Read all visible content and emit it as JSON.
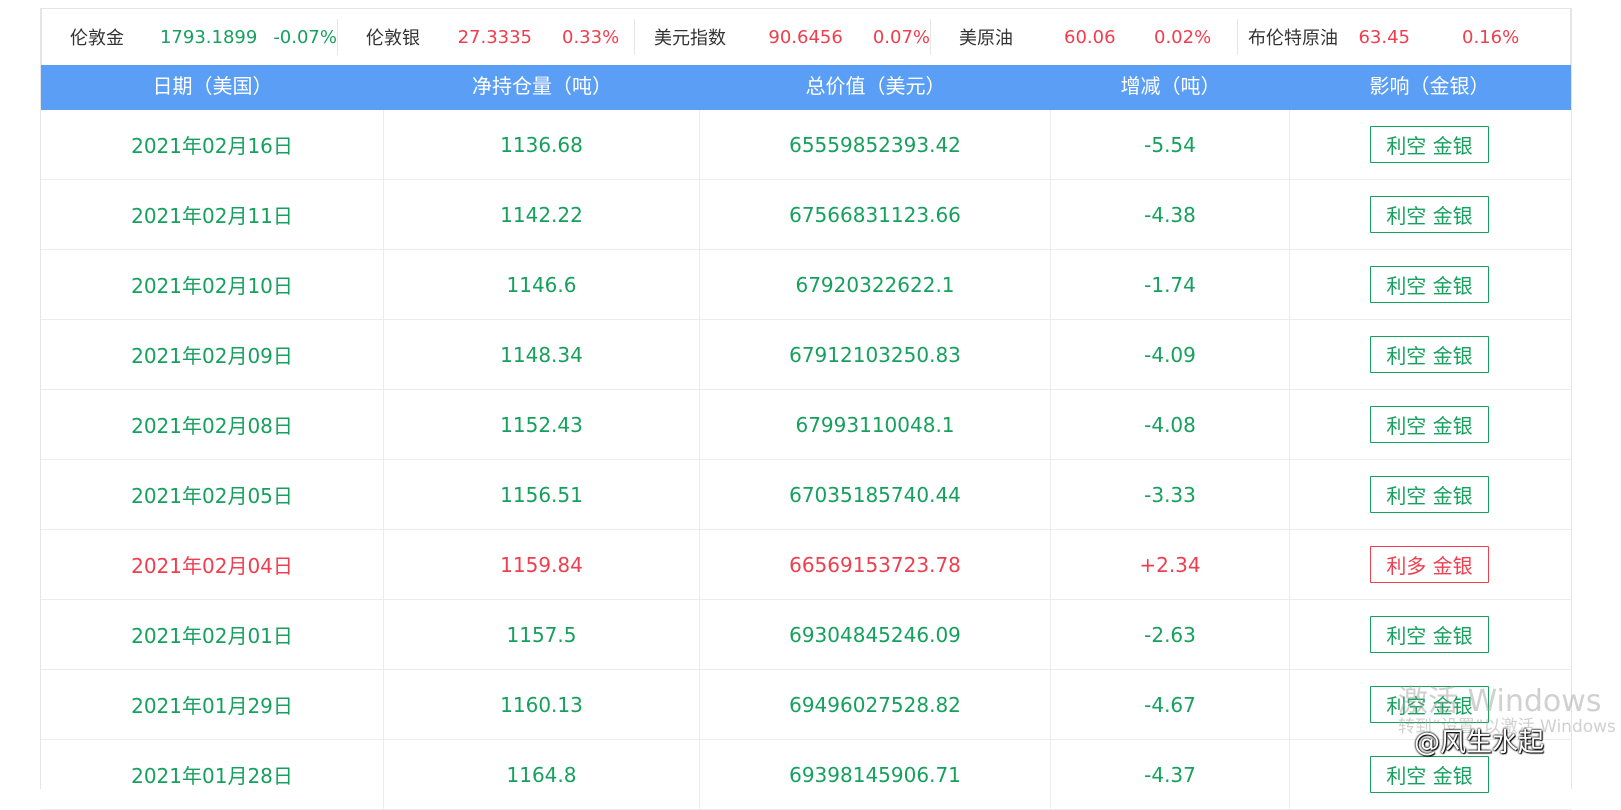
{
  "ticker": [
    {
      "name": "伦敦金",
      "price": "1793.1899",
      "change": "-0.07%",
      "trend": "down"
    },
    {
      "name": "伦敦银",
      "price": "27.3335",
      "change": "0.33%",
      "trend": "up"
    },
    {
      "name": "美元指数",
      "price": "90.6456",
      "change": "0.07%",
      "trend": "up"
    },
    {
      "name": "美原油",
      "price": "60.06",
      "change": "0.02%",
      "trend": "up"
    },
    {
      "name": "布伦特原油",
      "price": "63.45",
      "change": "0.16%",
      "trend": "up"
    }
  ],
  "table": {
    "headers": [
      "日期（美国）",
      "净持仓量（吨）",
      "总价值（美元）",
      "增减（吨）",
      "影响（金银）"
    ],
    "rows": [
      {
        "date": "2021年02月16日",
        "holdings": "1136.68",
        "value": "65559852393.42",
        "change": "-5.54",
        "impact": "利空 金银",
        "trend": "down"
      },
      {
        "date": "2021年02月11日",
        "holdings": "1142.22",
        "value": "67566831123.66",
        "change": "-4.38",
        "impact": "利空 金银",
        "trend": "down"
      },
      {
        "date": "2021年02月10日",
        "holdings": "1146.6",
        "value": "67920322622.1",
        "change": "-1.74",
        "impact": "利空 金银",
        "trend": "down"
      },
      {
        "date": "2021年02月09日",
        "holdings": "1148.34",
        "value": "67912103250.83",
        "change": "-4.09",
        "impact": "利空 金银",
        "trend": "down"
      },
      {
        "date": "2021年02月08日",
        "holdings": "1152.43",
        "value": "67993110048.1",
        "change": "-4.08",
        "impact": "利空 金银",
        "trend": "down"
      },
      {
        "date": "2021年02月05日",
        "holdings": "1156.51",
        "value": "67035185740.44",
        "change": "-3.33",
        "impact": "利空 金银",
        "trend": "down"
      },
      {
        "date": "2021年02月04日",
        "holdings": "1159.84",
        "value": "66569153723.78",
        "change": "+2.34",
        "impact": "利多 金银",
        "trend": "up"
      },
      {
        "date": "2021年02月01日",
        "holdings": "1157.5",
        "value": "69304845246.09",
        "change": "-2.63",
        "impact": "利空 金银",
        "trend": "down"
      },
      {
        "date": "2021年01月29日",
        "holdings": "1160.13",
        "value": "69496027528.82",
        "change": "-4.67",
        "impact": "利空 金银",
        "trend": "down"
      },
      {
        "date": "2021年01月28日",
        "holdings": "1164.8",
        "value": "69398145906.71",
        "change": "-4.37",
        "impact": "利空 金银",
        "trend": "down"
      }
    ]
  },
  "colors": {
    "up": "#ef3e4e",
    "down": "#16a05d",
    "header_bg": "#5b9ef5"
  },
  "overlay": {
    "windows_activation": "激活 Windows",
    "windows_activation_sub": "转到“设置”以激活 Windows",
    "weibo": "@风生水起"
  }
}
